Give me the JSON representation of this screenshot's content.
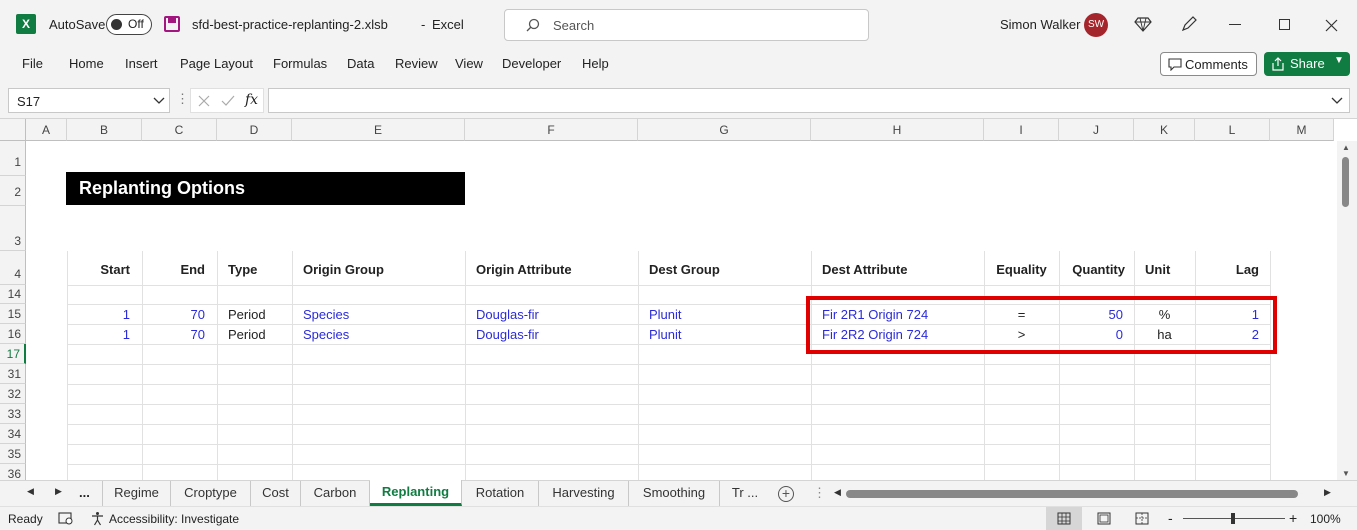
{
  "titlebar": {
    "autosave_label": "AutoSave",
    "autosave_state": "Off",
    "filename": "sfd-best-practice-replanting-2.xlsb",
    "separator": "-",
    "app_name": "Excel",
    "search_placeholder": "Search",
    "user_name": "Simon Walker",
    "user_initials": "SW"
  },
  "menu": [
    "File",
    "Home",
    "Insert",
    "Page Layout",
    "Formulas",
    "Data",
    "Review",
    "View",
    "Developer",
    "Help"
  ],
  "actions": {
    "comments": "Comments",
    "share": "Share"
  },
  "formula_bar": {
    "name_box": "S17",
    "fx": "fx",
    "formula": ""
  },
  "columns": [
    "A",
    "B",
    "C",
    "D",
    "E",
    "F",
    "G",
    "H",
    "I",
    "J",
    "K",
    "L",
    "M"
  ],
  "rows": [
    "1",
    "2",
    "3",
    "4",
    "14",
    "15",
    "16",
    "17",
    "31",
    "32",
    "33",
    "34",
    "35",
    "36"
  ],
  "sheet_title": "Replanting Options",
  "headers": {
    "start": "Start",
    "end": "End",
    "type": "Type",
    "origin_group": "Origin Group",
    "origin_attribute": "Origin Attribute",
    "dest_group": "Dest Group",
    "dest_attribute": "Dest Attribute",
    "equality": "Equality",
    "quantity": "Quantity",
    "unit": "Unit",
    "lag": "Lag"
  },
  "data_rows": [
    {
      "start": "1",
      "end": "70",
      "type": "Period",
      "origin_group": "Species",
      "origin_attribute": "Douglas-fir",
      "dest_group": "Plunit",
      "dest_attribute": "Fir 2R1 Origin 724",
      "equality": "=",
      "quantity": "50",
      "unit": "%",
      "lag": "1"
    },
    {
      "start": "1",
      "end": "70",
      "type": "Period",
      "origin_group": "Species",
      "origin_attribute": "Douglas-fir",
      "dest_group": "Plunit",
      "dest_attribute": "Fir 2R2 Origin 724",
      "equality": ">",
      "quantity": "0",
      "unit": "ha",
      "lag": "2"
    }
  ],
  "sheet_tabs": {
    "overflow": "...",
    "tabs": [
      "Regime",
      "Croptype",
      "Cost",
      "Carbon",
      "Replanting",
      "Rotation",
      "Harvesting",
      "Smoothing",
      "Tr ..."
    ],
    "active": "Replanting"
  },
  "status": {
    "ready": "Ready",
    "accessibility": "Accessibility: Investigate",
    "zoom": "100%",
    "minus": "-",
    "plus": "+"
  },
  "highlight_color": "#e00000",
  "accent_color": "#107c41"
}
